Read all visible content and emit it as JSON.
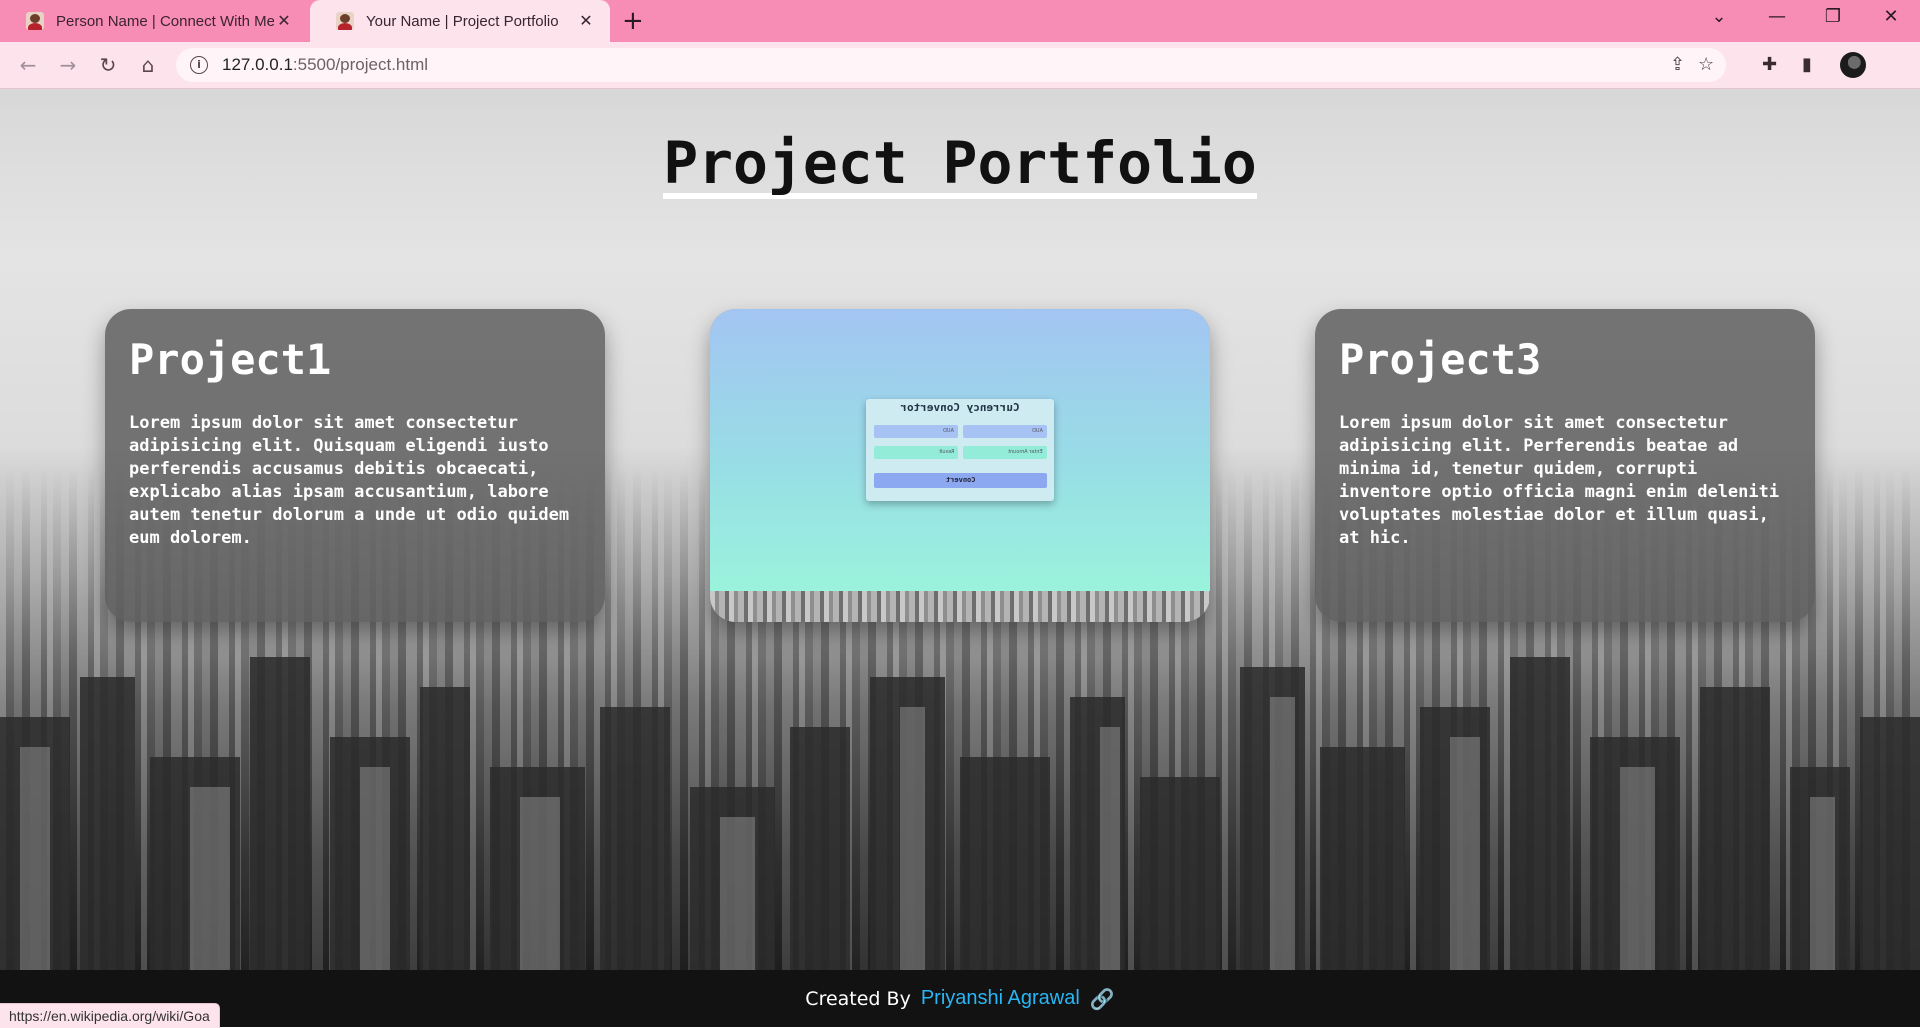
{
  "browser": {
    "tabs": [
      {
        "title": "Person Name | Connect With Me",
        "close": "✕",
        "active": false
      },
      {
        "title": "Your Name | Project Portfolio",
        "close": "✕",
        "active": true
      }
    ],
    "new_tab": "+",
    "window_controls": {
      "tab_search": "⌄",
      "minimize": "—",
      "restore": "❐",
      "close": "✕"
    },
    "nav": {
      "back": "←",
      "forward": "→",
      "reload": "↻",
      "home": "⌂"
    },
    "address": {
      "host": "127.0.0.1",
      "path": ":5500/project.html",
      "info_icon": "i"
    },
    "status_url": "https://en.wikipedia.org/wiki/Goa"
  },
  "page": {
    "title": "Project Portfolio",
    "projects": [
      {
        "title": "Project1",
        "description": "Lorem ipsum dolor sit amet consectetur adipisicing elit. Quisquam eligendi iusto perferendis accusamus debitis obcaecati, explicabo alias ipsam accusantium, labore autem tenetur dolorum a unde ut odio quidem eum dolorem."
      },
      {
        "preview": {
          "title": "Currency Convertor",
          "from_currency": "AUD",
          "to_currency": "AUD",
          "result_placeholder": "Result",
          "amount_placeholder": "Enter Amount",
          "button": "Convert"
        }
      },
      {
        "title": "Project3",
        "description": "Lorem ipsum dolor sit amet consectetur adipisicing elit. Perferendis beatae ad minima id, tenetur quidem, corrupti inventore optio officia magni enim deleniti voluptates molestiae dolor et illum quasi, at hic."
      }
    ],
    "footer": {
      "prefix": "Created By",
      "author": "Priyanshi Agrawal",
      "link_icon": "🔗"
    }
  },
  "colors": {
    "tabbar": "#f78db5",
    "toolbar": "#fde3ec",
    "card_bg": "#5a5a5a",
    "footer_bg": "#121212",
    "author_link": "#29b6f6"
  }
}
